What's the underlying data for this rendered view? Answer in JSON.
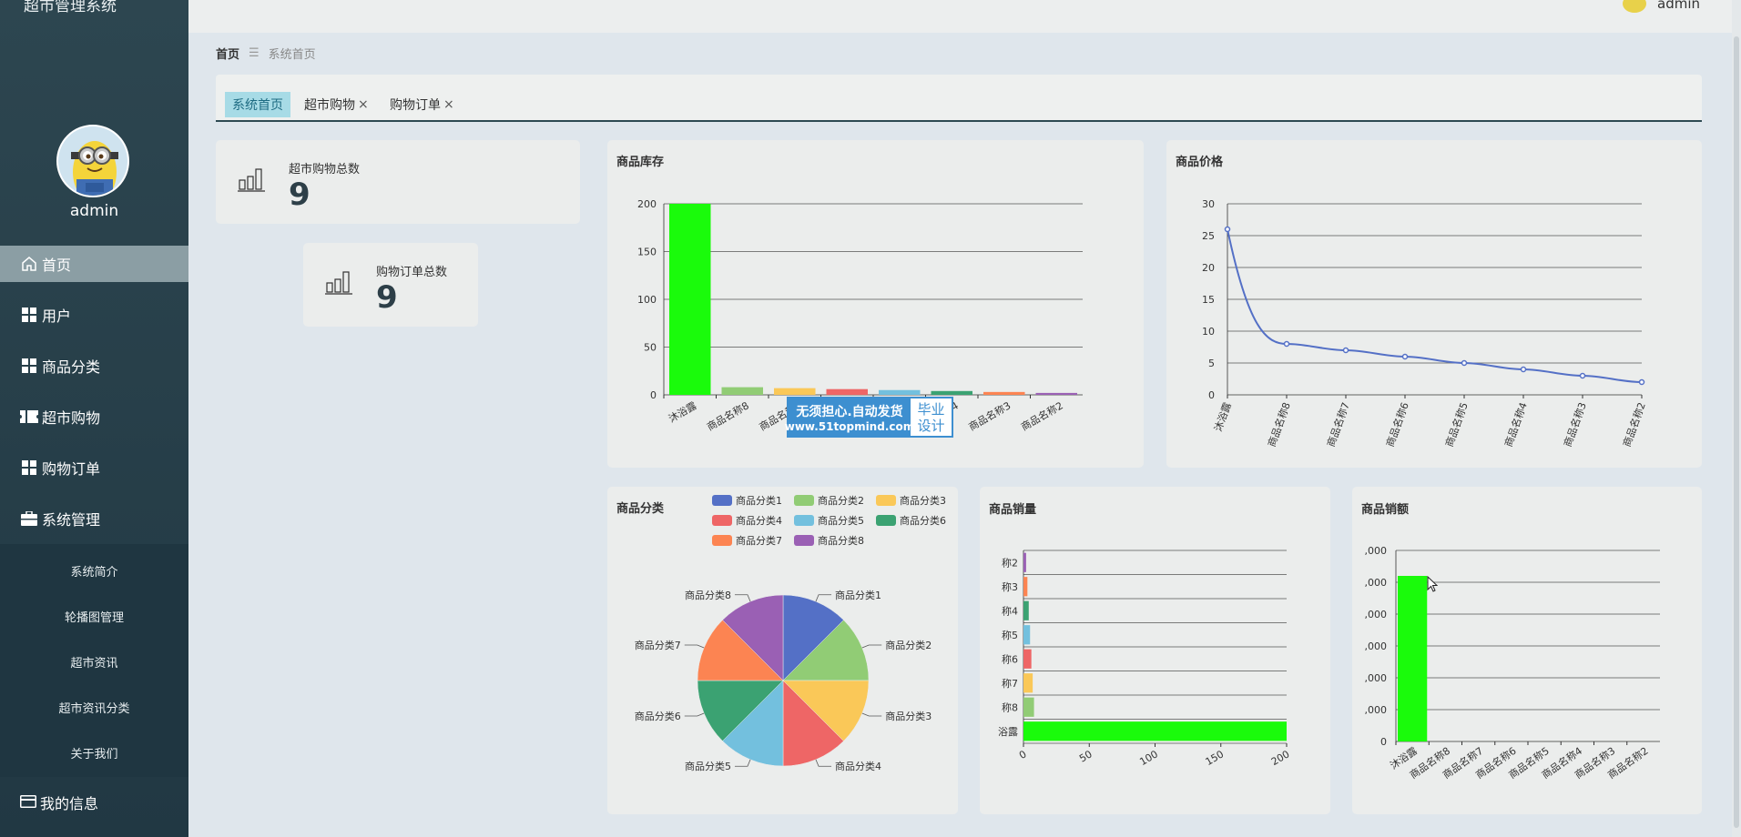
{
  "app": {
    "title": "超市管理系统",
    "user": "admin"
  },
  "sidebar": {
    "admin_name": "admin",
    "items": [
      {
        "label": "首页",
        "icon": "home-icon"
      },
      {
        "label": "用户",
        "icon": "grid-icon"
      },
      {
        "label": "商品分类",
        "icon": "grid-icon"
      },
      {
        "label": "超市购物",
        "icon": "ticket-icon"
      },
      {
        "label": "购物订单",
        "icon": "grid-icon"
      },
      {
        "label": "系统管理",
        "icon": "briefcase-icon"
      }
    ],
    "subitems": [
      "系统简介",
      "轮播图管理",
      "超市资讯",
      "超市资讯分类",
      "关于我们"
    ],
    "bottom": {
      "label": "我的信息",
      "icon": "card-icon"
    }
  },
  "breadcrumb": {
    "home": "首页",
    "sep": "☰",
    "current": "系统首页"
  },
  "tabs": [
    {
      "label": "系统首页",
      "closable": false
    },
    {
      "label": "超市购物",
      "closable": true
    },
    {
      "label": "购物订单",
      "closable": true
    }
  ],
  "tab_close_glyph": "×",
  "stats": [
    {
      "title": "超市购物总数",
      "value": "9"
    },
    {
      "title": "购物订单总数",
      "value": "9"
    }
  ],
  "watermark": {
    "line1": "无须担心.自动发货",
    "line2": "www.51topmind.com",
    "right1": "毕业",
    "right2": "设计"
  },
  "colors": {
    "bar_green": "#1afb0b",
    "line_blue": "#5470c6"
  },
  "chart_data": [
    {
      "id": "stock",
      "type": "bar",
      "title": "商品库存",
      "categories": [
        "沐浴露",
        "商品名称8",
        "商品名称7",
        "商品名称6",
        "商品名称5",
        "商品名称4",
        "商品名称3",
        "商品名称2"
      ],
      "values": [
        200,
        8,
        7,
        6,
        5,
        4,
        3,
        2
      ],
      "colors": [
        "#1afb0b",
        "#91cc75",
        "#fac858",
        "#ee6666",
        "#73c0de",
        "#3ba272",
        "#fc8452",
        "#9a60b4"
      ],
      "yticks": [
        0,
        50,
        100,
        150,
        200
      ],
      "ylim": [
        0,
        200
      ]
    },
    {
      "id": "price",
      "type": "line",
      "title": "商品价格",
      "categories": [
        "沐浴露",
        "商品名称8",
        "商品名称7",
        "商品名称6",
        "商品名称5",
        "商品名称4",
        "商品名称3",
        "商品名称2"
      ],
      "values": [
        26,
        8,
        7,
        6,
        5,
        4,
        3,
        2
      ],
      "yticks": [
        0,
        5,
        10,
        15,
        20,
        25,
        30
      ],
      "ylim": [
        0,
        30
      ]
    },
    {
      "id": "category",
      "type": "pie",
      "title": "商品分类",
      "labels": [
        "商品分类1",
        "商品分类2",
        "商品分类3",
        "商品分类4",
        "商品分类5",
        "商品分类6",
        "商品分类7",
        "商品分类8"
      ],
      "values": [
        1,
        1,
        1,
        1,
        1,
        1,
        1,
        1
      ],
      "colors": [
        "#5470c6",
        "#91cc75",
        "#fac858",
        "#ee6666",
        "#73c0de",
        "#3ba272",
        "#fc8452",
        "#9a60b4"
      ],
      "legend": "top"
    },
    {
      "id": "sales",
      "type": "bar",
      "orientation": "horizontal",
      "title": "商品销量",
      "categories": [
        "浴露",
        "称8",
        "称7",
        "称6",
        "称5",
        "称4",
        "称3",
        "称2"
      ],
      "values": [
        200,
        8,
        7,
        6,
        5,
        4,
        3,
        2
      ],
      "colors": [
        "#1afb0b",
        "#91cc75",
        "#fac858",
        "#ee6666",
        "#73c0de",
        "#3ba272",
        "#fc8452",
        "#9a60b4"
      ],
      "xticks": [
        "0",
        "50",
        "100",
        "150",
        "200"
      ],
      "xlim": [
        0,
        200
      ]
    },
    {
      "id": "revenue",
      "type": "bar",
      "title": "商品销额",
      "categories": [
        "沐浴露",
        "商品名称8",
        "商品名称7",
        "商品名称6",
        "商品名称5",
        "商品名称4",
        "商品名称3",
        "商品名称2"
      ],
      "values": [
        5200,
        0,
        0,
        0,
        0,
        0,
        0,
        0
      ],
      "colors": [
        "#1afb0b"
      ],
      "yticks": [
        "0",
        ",000",
        ",000",
        ",000",
        ",000",
        ",000",
        ",000"
      ],
      "ylim": [
        0,
        6000
      ]
    }
  ]
}
